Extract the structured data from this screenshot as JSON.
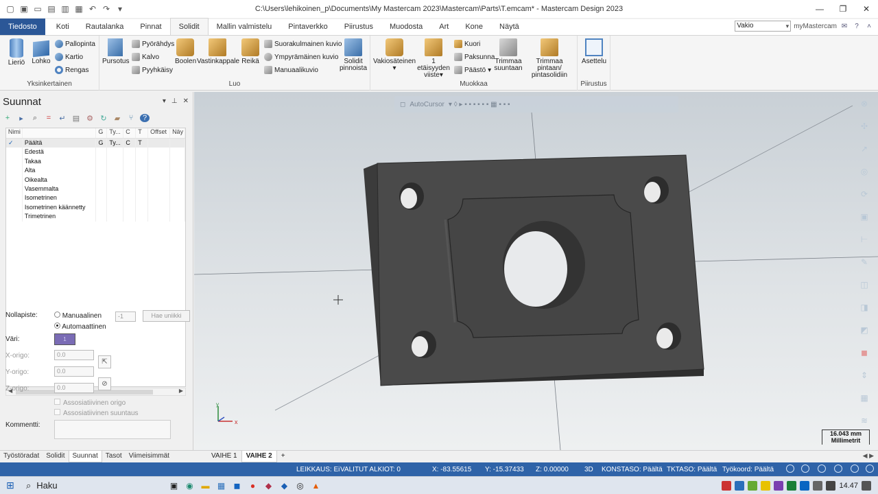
{
  "titlebar": {
    "title": "C:\\Users\\lehikoinen_p\\Documents\\My Mastercam 2023\\Mastercam\\Parts\\T.emcam* - Mastercam Design 2023"
  },
  "tabs": [
    "Tiedosto",
    "Koti",
    "Rautalanka",
    "Pinnat",
    "Solidit",
    "Mallin valmistelu",
    "Pintaverkko",
    "Piirustus",
    "Muodosta",
    "Art",
    "Kone",
    "Näytä"
  ],
  "active_tab": "Solidit",
  "preset": "Vakio",
  "my_mastercam": "myMastercam",
  "ribbon": {
    "groups": {
      "simple": "Yksinkertainen",
      "create": "Luo",
      "modify": "Muokkaa",
      "layout": "Piirustus"
    },
    "buttons": {
      "cylinder": "Lieriö",
      "block": "Lohko",
      "sphere": "Pallopinta",
      "cone": "Kartio",
      "torus": "Rengas",
      "extrude": "Pursotus",
      "revolve": "Pyörähdys",
      "loft": "Kalvo",
      "sweep": "Pyyhkäisy",
      "boolean": "Boolen",
      "counterpart": "Vastinkappale",
      "hole": "Reikä",
      "rect_pattern": "Suorakulmainen kuvio",
      "circ_pattern": "Ympyrämäinen kuvio",
      "manual_pattern": "Manuaalikuvio",
      "solid_from_surfaces_1": "Solidit",
      "solid_from_surfaces_2": "pinnoista",
      "const_fillet_1": "Vakiosäteinen",
      "dist_chamfer_1": "1 etäisyyden",
      "dist_chamfer_2": "viiste",
      "shell": "Kuori",
      "thicken": "Paksunna",
      "draft": "Päästö",
      "trim_plane_1": "Trimmaa",
      "trim_plane_2": "suuntaan",
      "trim_surf_1": "Trimmaa pintaan/",
      "trim_surf_2": "pintasolidiin",
      "layout": "Asettelu"
    }
  },
  "panel": {
    "title": "Suunnat",
    "columns": [
      "Nimi",
      "G",
      "Ty...",
      "C",
      "T",
      "Offset",
      "Näy"
    ],
    "rows": [
      {
        "check": "✓",
        "name": "Päältä",
        "g": "G",
        "ty": "Ty...",
        "c": "C",
        "t": "T"
      },
      {
        "check": "",
        "name": "Edestä",
        "g": "",
        "ty": "",
        "c": "",
        "t": ""
      },
      {
        "check": "",
        "name": "Takaa",
        "g": "",
        "ty": "",
        "c": "",
        "t": ""
      },
      {
        "check": "",
        "name": "Alta",
        "g": "",
        "ty": "",
        "c": "",
        "t": ""
      },
      {
        "check": "",
        "name": "Oikealta",
        "g": "",
        "ty": "",
        "c": "",
        "t": ""
      },
      {
        "check": "",
        "name": "Vasemmalta",
        "g": "",
        "ty": "",
        "c": "",
        "t": ""
      },
      {
        "check": "",
        "name": "Isometrinen",
        "g": "",
        "ty": "",
        "c": "",
        "t": ""
      },
      {
        "check": "",
        "name": "Isometrinen käännetty",
        "g": "",
        "ty": "",
        "c": "",
        "t": ""
      },
      {
        "check": "",
        "name": "Trimetrinen",
        "g": "",
        "ty": "",
        "c": "",
        "t": ""
      }
    ],
    "form": {
      "nollapiste_label": "Nollapiste:",
      "manual_label": "Manuaalinen",
      "manual_value": "-1",
      "get_unique": "Hae uniikki",
      "auto_label": "Automaattinen",
      "color_label": "Väri:",
      "color_value": "1",
      "x_label": "X-origo:",
      "x_value": "0.0",
      "y_label": "Y-origo:",
      "y_value": "0.0",
      "z_label": "Z-origo:",
      "z_value": "0.0",
      "assoc_origin": "Assosiatiivinen origo",
      "assoc_dir": "Assosiatiivinen suuntaus",
      "comment_label": "Kommentti:"
    }
  },
  "bottom_tabs": [
    "Työstöradat",
    "Solidit",
    "Suunnat",
    "Tasot",
    "Viimeisimmät"
  ],
  "bottom_active": "Suunnat",
  "view_tabs": [
    "VAIHE 1",
    "VAIHE 2"
  ],
  "view_active": "VAIHE 2",
  "viewport": {
    "autocursor": "AutoCursor",
    "scale_value": "16.043 mm",
    "scale_unit": "Millimetrit",
    "axis_y": "y",
    "axis_x": "x"
  },
  "status": {
    "cut": "LEIKKAUS: Ei",
    "selected": "VALITUT ALKIOT: 0",
    "x": "X:   -83.55615",
    "y": "Y:   -15.37433",
    "z": "Z:   0.00000",
    "mode": "3D",
    "construct": "KONSTASO: Päältä",
    "tool": "TKTASO: Päältä",
    "wcs": "Työkoord: Päältä"
  },
  "taskbar": {
    "search": "Haku",
    "time": "14.47"
  },
  "colors": {
    "file_tab": "#2b5797",
    "status_bar": "#2f63a8",
    "part": "#4a4a4a"
  }
}
